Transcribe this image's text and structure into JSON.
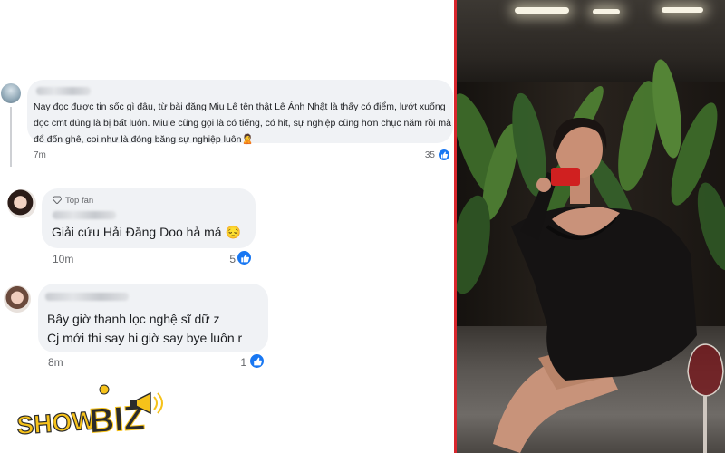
{
  "comments": [
    {
      "text": "Nay đọc được tin sốc gì đâu, từ bài đăng Miu Lê tên thật Lê Ánh Nhật là thấy có điểm, lướt xuống đọc cmt đúng là bị bất luôn. Miule cũng gọi là có tiếng, có hit, sự nghiệp cũng hơn chục năm rồi mà đổ đốn ghê, coi như là đóng băng sự nghiệp luôn🙎",
      "time": "7m",
      "reactions": "35"
    },
    {
      "badge": "Top fan",
      "text": "Giải cứu Hải Đăng Doo hả má 😔",
      "time": "10m",
      "reactions": "5"
    },
    {
      "lines": [
        "Bây giờ thanh lọc nghệ sĩ dữ z",
        "Cj mới thi say hi giờ say bye luôn r"
      ],
      "time": "8m",
      "reactions": "1"
    }
  ],
  "logo": {
    "part1": "SHOW",
    "part2": "BIZ"
  },
  "colors": {
    "bubble": "#f0f2f5",
    "like_blue": "#1877f2",
    "divider_red": "#d8262d",
    "logo_yellow": "#f6c21a",
    "logo_dark": "#2b2b2b"
  },
  "icons": [
    "like-icon",
    "diamond-icon",
    "megaphone-icon"
  ]
}
